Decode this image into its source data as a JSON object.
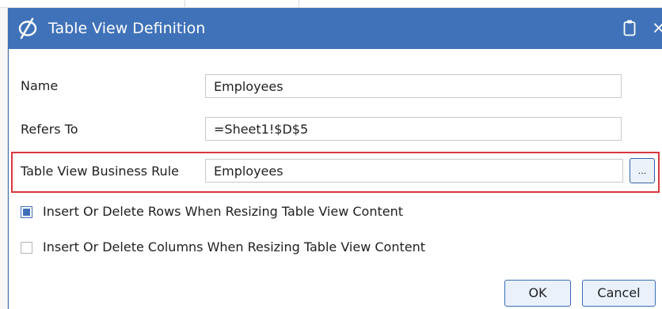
{
  "dialog": {
    "title": "Table View Definition",
    "icons": {
      "logo": "oracle-swoosh-icon",
      "clipboard": "clipboard-icon",
      "close": "close-icon"
    },
    "close_glyph": "×"
  },
  "form": {
    "name_label": "Name",
    "name_value": "Employees",
    "refers_to_label": "Refers To",
    "refers_to_value": "=Sheet1!$D$5",
    "business_rule_label": "Table View Business Rule",
    "business_rule_value": "Employees",
    "browse_label": "..."
  },
  "options": [
    {
      "label": "Insert Or Delete Rows When Resizing Table View Content",
      "checked": true
    },
    {
      "label": "Insert Or Delete Columns When Resizing Table View Content",
      "checked": false
    }
  ],
  "buttons": {
    "ok_label": "OK",
    "cancel_label": "Cancel"
  },
  "colors": {
    "titlebar": "#3f72b8",
    "accent": "#3f6fb5",
    "highlight": "#d9363e"
  }
}
